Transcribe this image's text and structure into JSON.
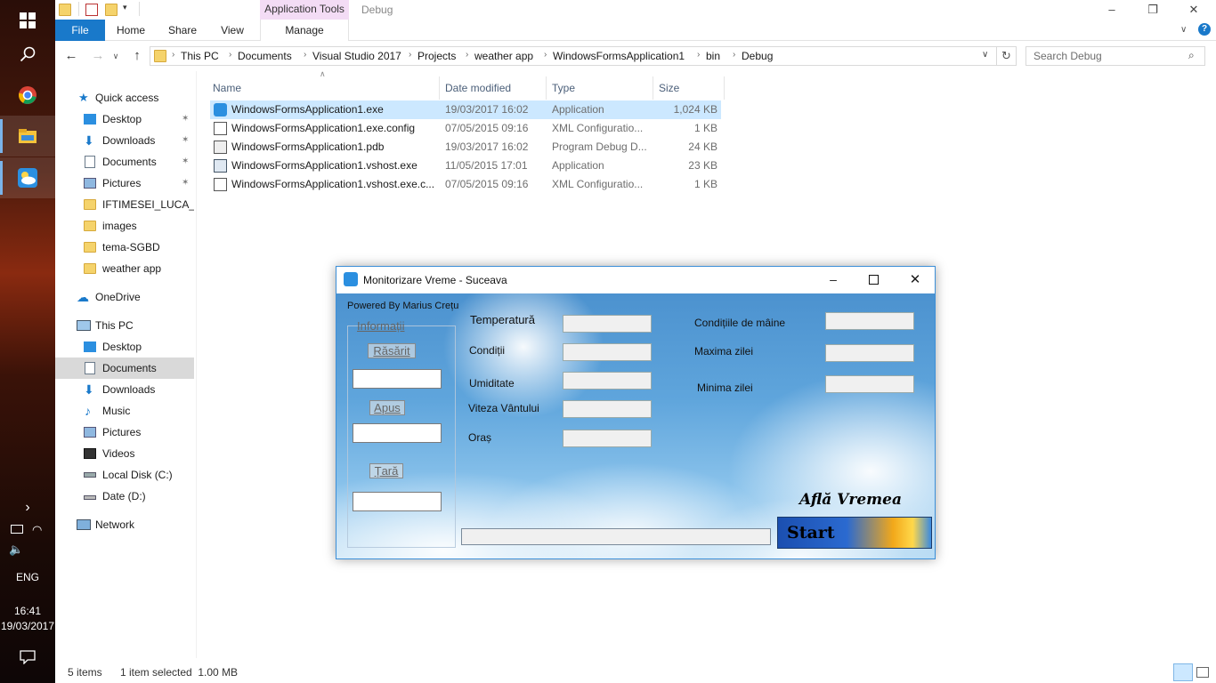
{
  "taskbar": {
    "language": "ENG",
    "time": "16:41",
    "date": "19/03/2017"
  },
  "explorer": {
    "contextual_tab_group": "Application Tools",
    "window_title": "Debug",
    "ribbon_tabs": [
      "File",
      "Home",
      "Share",
      "View",
      "Manage"
    ],
    "breadcrumb": [
      "This PC",
      "Documents",
      "Visual Studio 2017",
      "Projects",
      "weather app",
      "WindowsFormsApplication1",
      "bin",
      "Debug"
    ],
    "search_placeholder": "Search Debug",
    "nav_pane": {
      "quick_access": "Quick access",
      "quick_items": [
        "Desktop",
        "Downloads",
        "Documents",
        "Pictures",
        "IFTIMESEI_LUCA_pr",
        "images",
        "tema-SGBD",
        "weather app"
      ],
      "onedrive": "OneDrive",
      "this_pc": "This PC",
      "pc_items": [
        "Desktop",
        "Documents",
        "Downloads",
        "Music",
        "Pictures",
        "Videos",
        "Local Disk (C:)",
        "Date (D:)"
      ],
      "network": "Network",
      "selected": "Documents"
    },
    "columns": [
      "Name",
      "Date modified",
      "Type",
      "Size"
    ],
    "files": [
      {
        "name": "WindowsFormsApplication1.exe",
        "date": "19/03/2017 16:02",
        "type": "Application",
        "size": "1,024 KB",
        "selected": true
      },
      {
        "name": "WindowsFormsApplication1.exe.config",
        "date": "07/05/2015 09:16",
        "type": "XML Configuratio...",
        "size": "1 KB"
      },
      {
        "name": "WindowsFormsApplication1.pdb",
        "date": "19/03/2017 16:02",
        "type": "Program Debug D...",
        "size": "24 KB"
      },
      {
        "name": "WindowsFormsApplication1.vshost.exe",
        "date": "11/05/2015 17:01",
        "type": "Application",
        "size": "23 KB"
      },
      {
        "name": "WindowsFormsApplication1.vshost.exe.c...",
        "date": "07/05/2015 09:16",
        "type": "XML Configuratio...",
        "size": "1 KB"
      }
    ],
    "status": {
      "items": "5 items",
      "selection": "1 item selected  1.00 MB"
    }
  },
  "app": {
    "title": "Monitorizare Vreme - Suceava",
    "powered_by": "Powered By Marius Crețu",
    "group_title": "Informații",
    "sunrise_label": "Răsărit",
    "sunset_label": "Apus",
    "country_label": "Țară",
    "temperature_label": "Temperatură",
    "conditions_label": "Condiții",
    "humidity_label": "Umiditate",
    "wind_label": "Viteza Vântului",
    "city_label": "Oraș",
    "tomorrow_conditions_label": "Condițiile de mâine",
    "max_label": "Maxima zilei",
    "min_label": "Minima zilei",
    "logo_text": "Află Vremea",
    "start_label": "Start"
  }
}
